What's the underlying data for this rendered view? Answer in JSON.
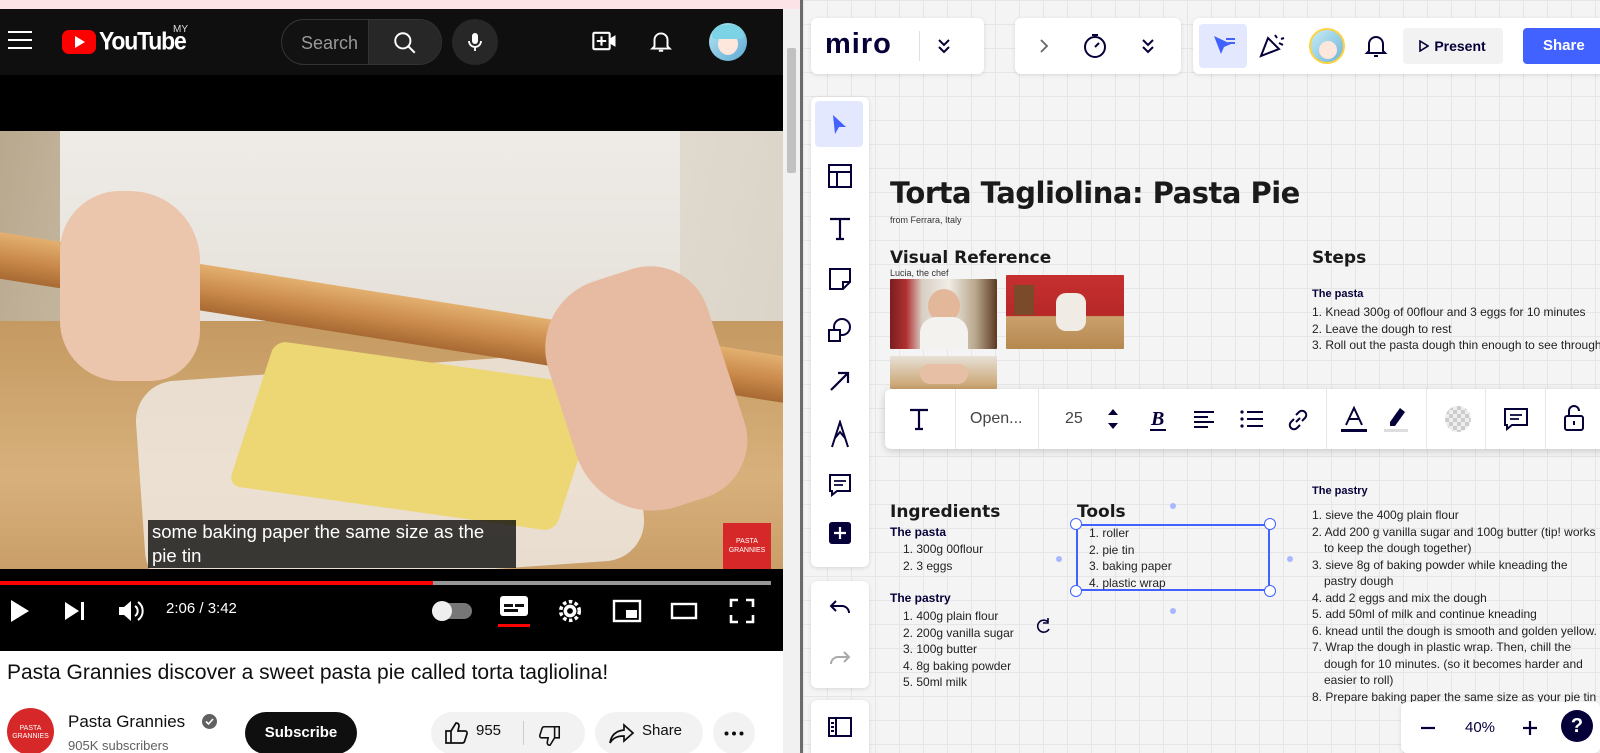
{
  "youtube": {
    "logo_text": "YouTube",
    "region": "MY",
    "search_placeholder": "Search",
    "caption": "some baking paper the same size as the pie tin",
    "channel_logo_text": "PASTA GRANNIES",
    "progress_fraction": 0.562,
    "time": "2:06 / 3:42",
    "video_title": "Pasta Grannies discover a sweet pasta pie called torta tagliolina!",
    "channel_name": "Pasta Grannies",
    "channel_avatar_text": "PASTA GRANNIES",
    "subscribers": "905K subscribers",
    "subscribe_label": "Subscribe",
    "likes": "955",
    "share_label": "Share",
    "accent": "#ff0000"
  },
  "miro": {
    "logo": "miro",
    "present_label": "Present",
    "share_label": "Share",
    "accent": "#4262ff",
    "board": {
      "title": "Torta Tagliolina: Pasta Pie",
      "subtitle": "from Ferrara, Italy",
      "visual_heading": "Visual Reference",
      "visual_caption": "Lucia, the chef",
      "steps_heading": "Steps",
      "steps_pasta_heading": "The pasta",
      "steps_pasta": [
        "1. Knead 300g of 00flour and 3 eggs for 10 minutes",
        "2. Leave the dough to rest",
        "3. Roll out the pasta dough thin enough to see through"
      ],
      "steps_pastry_heading": "The pastry",
      "steps_pastry": [
        "1. sieve the 400g plain flour",
        "2. Add 200 g vanilla sugar and 100g butter (tip! works to keep the dough together)",
        "3. sieve 8g of baking powder while kneading the pastry dough",
        "4. add 2 eggs and mix the dough",
        "5. add 50ml of milk and continue kneading",
        "6. knead until the dough is smooth and golden yellow.",
        "7. Wrap the dough in plastic wrap. Then, chill the dough for 10 minutes. (so it becomes harder and easier to roll)",
        "8. Prepare baking paper the same size as your pie tin"
      ],
      "ingredients_heading": "Ingredients",
      "ing_pasta_heading": "The pasta",
      "ing_pasta": [
        "1. 300g 00flour",
        "2. 3 eggs"
      ],
      "ing_pastry_heading": "The pastry",
      "ing_pastry": [
        "1. 400g plain flour",
        "2. 200g vanilla sugar",
        "3. 100g butter",
        "4. 8g baking powder",
        "5. 50ml milk"
      ],
      "tools_heading": "Tools",
      "tools": [
        "1. roller",
        "2. pie tin",
        "3. baking paper",
        "4. plastic wrap"
      ]
    },
    "format_bar": {
      "font": "Open...",
      "size": "25"
    },
    "zoom": "40%",
    "help": "?"
  }
}
